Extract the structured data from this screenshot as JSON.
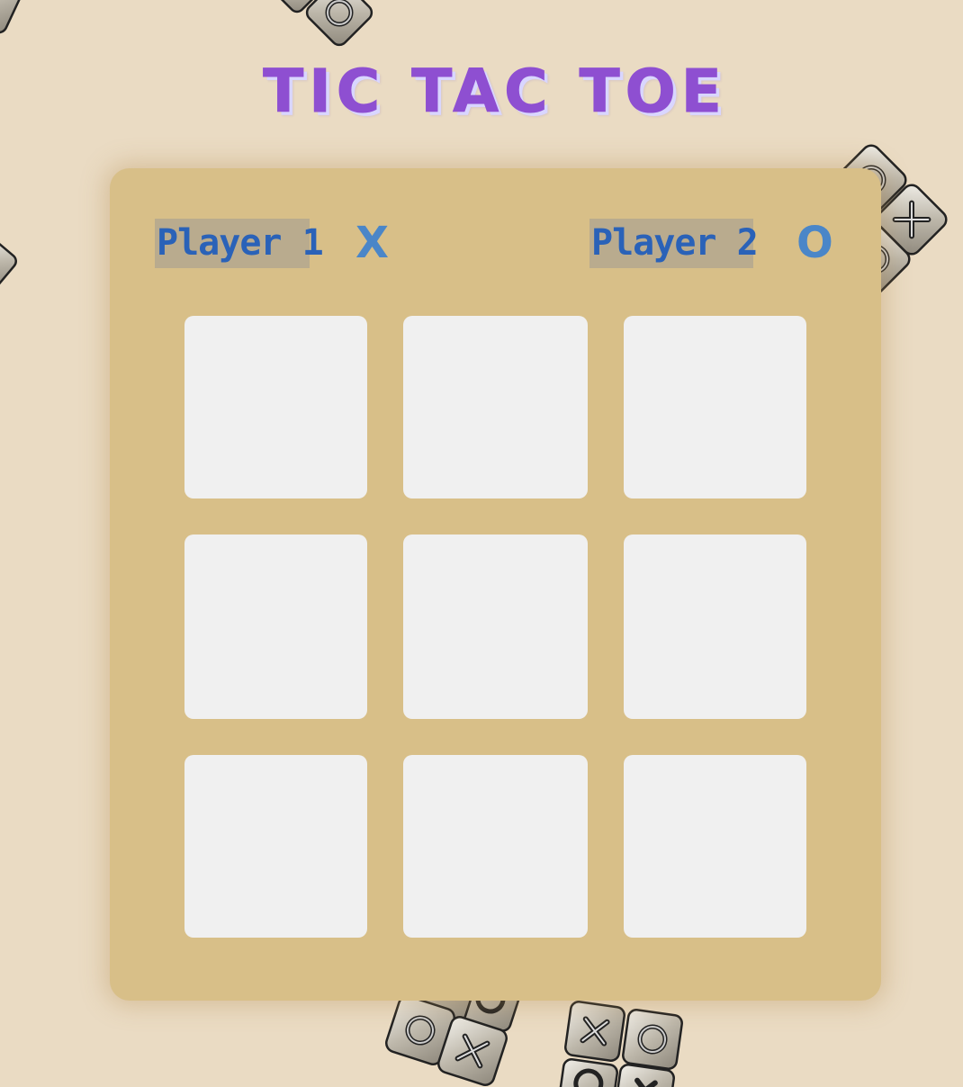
{
  "title": "TIC TAC TOE",
  "players": [
    {
      "label": "Player 1",
      "symbol": "X"
    },
    {
      "label": "Player 2",
      "symbol": "O"
    }
  ],
  "board": [
    [
      "",
      "",
      ""
    ],
    [
      "",
      "",
      ""
    ],
    [
      "",
      "",
      ""
    ]
  ],
  "colors": {
    "background": "#eadbc3",
    "panel": "#d8bf88",
    "title": "#8e4fd1",
    "player_label": "#2a62b8",
    "symbol": "#4a86c8",
    "cell": "#f0f0f0"
  },
  "decorations": {
    "tile_marks": [
      "O",
      "X",
      "O",
      "X",
      "O",
      "O",
      "X",
      "O",
      "X",
      "O",
      "X"
    ]
  }
}
